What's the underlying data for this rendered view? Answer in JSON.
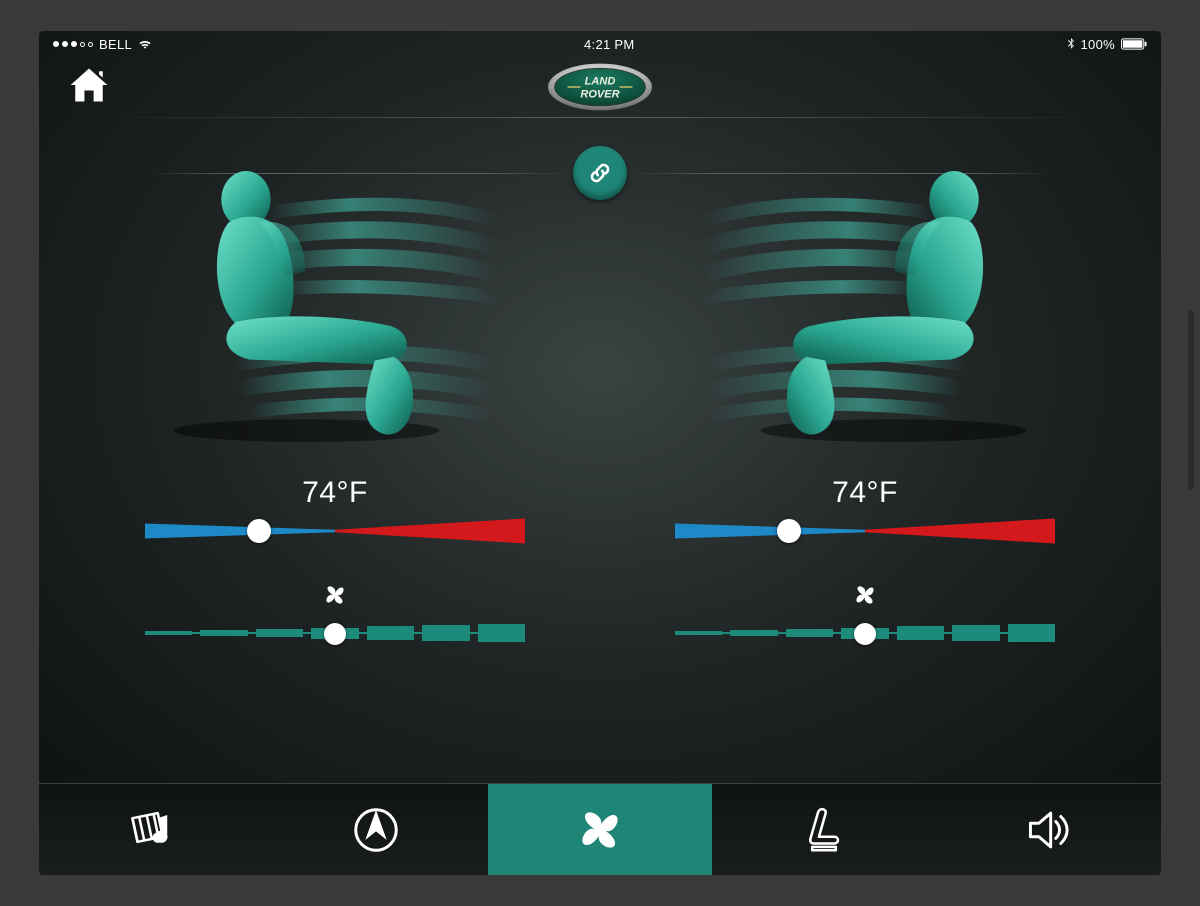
{
  "status": {
    "carrier": "BELL",
    "time": "4:21 PM",
    "battery_pct": "100%",
    "signal_dots_filled": 3,
    "signal_dots_total": 5
  },
  "brand": {
    "line1": "LAND",
    "line2": "ROVER"
  },
  "colors": {
    "accent": "#1f8576",
    "cold": "#1d89c7",
    "hot": "#d3191b"
  },
  "climate": {
    "sync_linked": true,
    "left": {
      "temp_display": "74°F",
      "temp_slider_pct": 30,
      "fan_level": 4,
      "fan_max": 7
    },
    "right": {
      "temp_display": "74°F",
      "temp_slider_pct": 30,
      "fan_level": 4,
      "fan_max": 7
    }
  },
  "nav": {
    "items": [
      {
        "id": "media",
        "name": "media-tab",
        "active": false
      },
      {
        "id": "nav",
        "name": "navigation-tab",
        "active": false
      },
      {
        "id": "climate",
        "name": "climate-tab",
        "active": true
      },
      {
        "id": "seats",
        "name": "seats-tab",
        "active": false
      },
      {
        "id": "audio",
        "name": "audio-tab",
        "active": false
      }
    ]
  }
}
